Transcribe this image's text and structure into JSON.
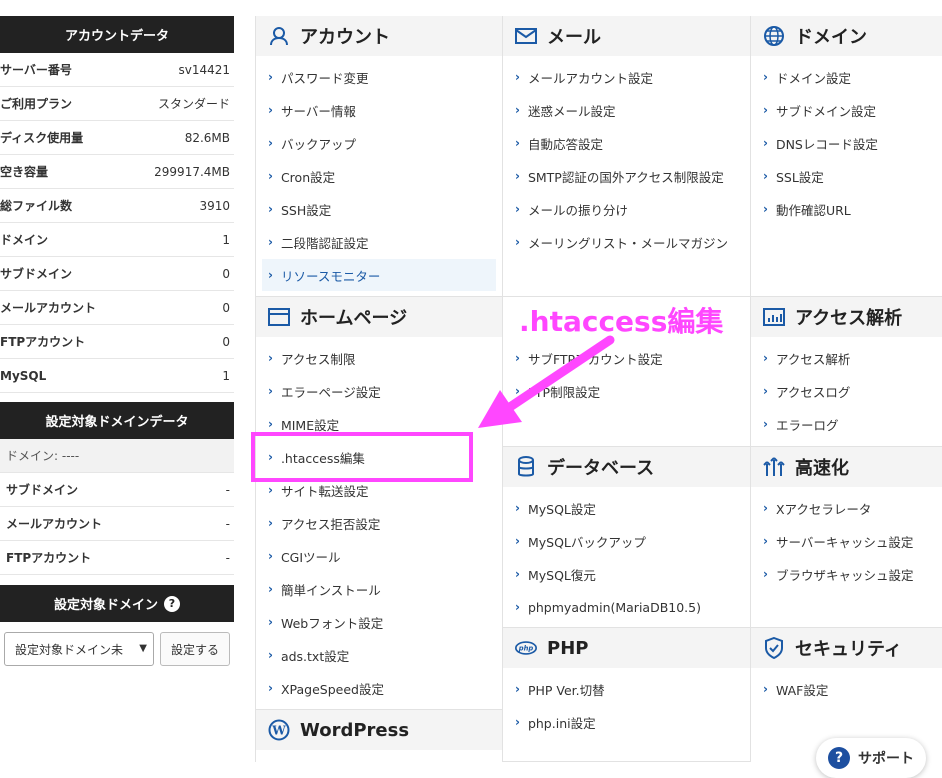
{
  "sidebar": {
    "account_title": "アカウントデータ",
    "account_rows": [
      {
        "label": "サーバー番号",
        "value": "sv14421"
      },
      {
        "label": "ご利用プラン",
        "value": "スタンダード"
      },
      {
        "label": "ディスク使用量",
        "value": "82.6MB"
      },
      {
        "label": "空き容量",
        "value": "299917.4MB"
      },
      {
        "label": "総ファイル数",
        "value": "3910"
      },
      {
        "label": "ドメイン",
        "value": "1"
      },
      {
        "label": "サブドメイン",
        "value": "0"
      },
      {
        "label": "メールアカウント",
        "value": "0"
      },
      {
        "label": "FTPアカウント",
        "value": "0"
      },
      {
        "label": "MySQL",
        "value": "1"
      }
    ],
    "domain_title": "設定対象ドメインデータ",
    "domain_label": "ドメイン: ----",
    "domain_rows": [
      {
        "label": "サブドメイン",
        "value": "-"
      },
      {
        "label": "メールアカウント",
        "value": "-"
      },
      {
        "label": "FTPアカウント",
        "value": "-"
      }
    ],
    "target_title": "設定対象ドメイン",
    "target_help_icon": "?",
    "select_value": "設定対象ドメイン未",
    "set_button": "設定する"
  },
  "panels": {
    "account": {
      "title": "アカウント",
      "items": [
        "パスワード変更",
        "サーバー情報",
        "バックアップ",
        "Cron設定",
        "SSH設定",
        "二段階認証設定",
        "リソースモニター"
      ]
    },
    "mail": {
      "title": "メール",
      "items": [
        "メールアカウント設定",
        "迷惑メール設定",
        "自動応答設定",
        "SMTP認証の国外アクセス制限設定",
        "メールの振り分け",
        "メーリングリスト・メールマガジン"
      ]
    },
    "domain": {
      "title": "ドメイン",
      "items": [
        "ドメイン設定",
        "サブドメイン設定",
        "DNSレコード設定",
        "SSL設定",
        "動作確認URL"
      ]
    },
    "homepage": {
      "title": "ホームページ",
      "items": [
        "アクセス制限",
        "エラーページ設定",
        "MIME設定",
        ".htaccess編集",
        "サイト転送設定",
        "アクセス拒否設定",
        "CGIツール",
        "簡単インストール",
        "Webフォント設定",
        "ads.txt設定",
        "XPageSpeed設定"
      ]
    },
    "ftp": {
      "items": [
        "サブFTPアカウント設定",
        "FTP制限設定"
      ]
    },
    "analytics": {
      "title": "アクセス解析",
      "items": [
        "アクセス解析",
        "アクセスログ",
        "エラーログ"
      ]
    },
    "database": {
      "title": "データベース",
      "items": [
        "MySQL設定",
        "MySQLバックアップ",
        "MySQL復元",
        "phpmyadmin(MariaDB10.5)"
      ]
    },
    "speed": {
      "title": "高速化",
      "items": [
        "Xアクセラレータ",
        "サーバーキャッシュ設定",
        "ブラウザキャッシュ設定"
      ]
    },
    "php": {
      "title": "PHP",
      "items": [
        "PHP Ver.切替",
        "php.ini設定"
      ]
    },
    "security": {
      "title": "セキュリティ",
      "items": [
        "WAF設定"
      ]
    },
    "wordpress": {
      "title": "WordPress"
    }
  },
  "annotation": {
    "text": ".htaccess編集",
    "color": "#ff47ff"
  },
  "support": {
    "label": "サポート",
    "icon": "?"
  },
  "colors": {
    "accent": "#1b5aa6",
    "highlight": "#ff47ff",
    "dark": "#222222"
  }
}
